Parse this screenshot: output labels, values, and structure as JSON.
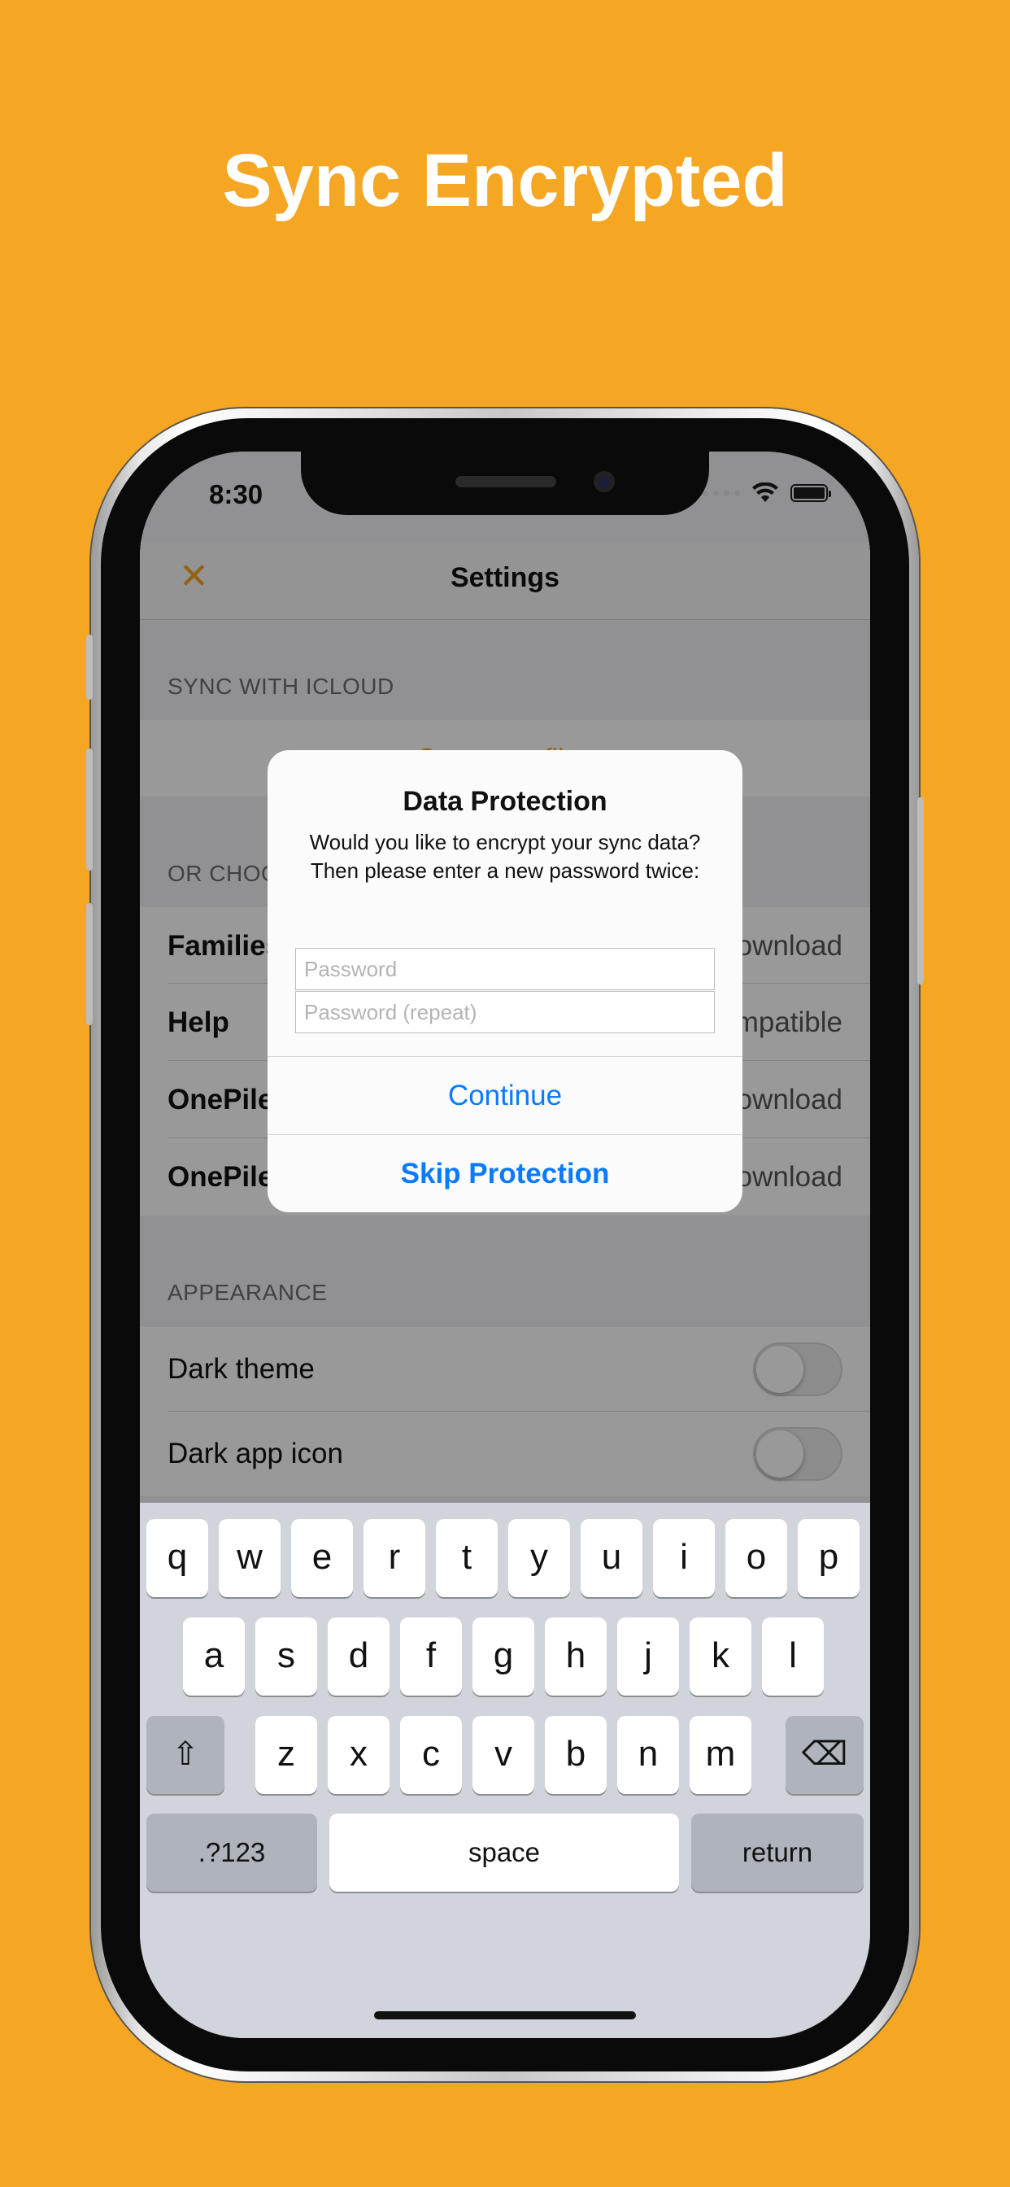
{
  "headline": "Sync Encrypted",
  "status_bar": {
    "time": "8:30"
  },
  "nav": {
    "close_icon": "✕",
    "title": "Settings"
  },
  "sections": {
    "sync_header": "SYNC WITH ICLOUD",
    "sync_row_text": "Sync your files",
    "choose_header": "OR CHOOSE",
    "rows": [
      {
        "label": "Families",
        "value": "Download"
      },
      {
        "label": "Help",
        "value": "Compatible"
      },
      {
        "label": "OnePile",
        "value": "Download"
      },
      {
        "label": "OnePile",
        "value": "Download"
      }
    ],
    "appearance_header": "APPEARANCE",
    "toggles": [
      {
        "label": "Dark theme",
        "on": false
      },
      {
        "label": "Dark app icon",
        "on": false
      }
    ]
  },
  "dialog": {
    "title": "Data Protection",
    "message": "Would you like to encrypt your sync data? Then please enter a new password twice:",
    "password_placeholder": "Password",
    "password_repeat_placeholder": "Password (repeat)",
    "continue_label": "Continue",
    "skip_label": "Skip Protection"
  },
  "keyboard": {
    "row1": [
      "q",
      "w",
      "e",
      "r",
      "t",
      "y",
      "u",
      "i",
      "o",
      "p"
    ],
    "row2": [
      "a",
      "s",
      "d",
      "f",
      "g",
      "h",
      "j",
      "k",
      "l"
    ],
    "row3": [
      "z",
      "x",
      "c",
      "v",
      "b",
      "n",
      "m"
    ],
    "shift_icon": "⇧",
    "delete_icon": "⌫",
    "numbers_label": ".?123",
    "space_label": "space",
    "return_label": "return"
  },
  "colors": {
    "background": "#F5A623",
    "accent": "#F5A623",
    "link": "#0A7AFF"
  }
}
